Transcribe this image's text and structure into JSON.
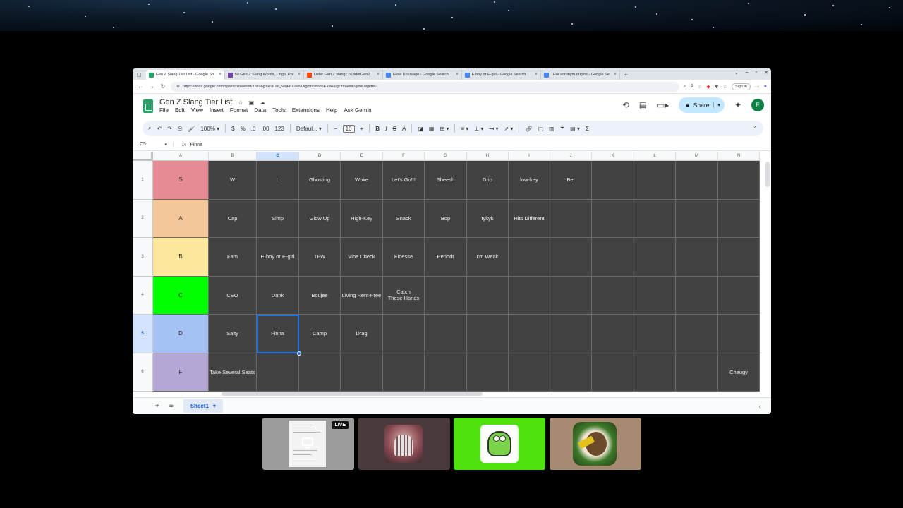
{
  "browser": {
    "tabs": [
      {
        "title": "Gen Z Slang Tier List - Google Sh",
        "fav_color": "#1fa463",
        "active": true
      },
      {
        "title": "50 Gen Z Slang Words, Lingo, Phr",
        "fav_color": "#6e3fa8",
        "active": false
      },
      {
        "title": "Older Gen Z slang : r/OlderGenZ",
        "fav_color": "#ff4500",
        "active": false
      },
      {
        "title": "Glow Up usage - Google Search",
        "fav_color": "#4285f4",
        "active": false
      },
      {
        "title": "E-boy or E-girl - Google Search",
        "fav_color": "#4285f4",
        "active": false
      },
      {
        "title": "TFW acronym origins - Google Se",
        "fav_color": "#4285f4",
        "active": false
      }
    ],
    "url": "https://docs.google.com/spreadsheets/d/18Ju6gYRDOeQViqFhXaw9UIgl5hbXod5EaWuugcItio/edit?gid=0#gid=0",
    "signin_label": "Sign in"
  },
  "sheet": {
    "title": "Gen Z Slang Tier List",
    "menu": [
      "File",
      "Edit",
      "View",
      "Insert",
      "Format",
      "Data",
      "Tools",
      "Extensions",
      "Help",
      "Ask Gemini"
    ],
    "share_label": "Share",
    "avatar_letter": "E",
    "toolbar": {
      "zoom": "100%",
      "font": "Defaul...",
      "font_size": "10",
      "percent": "%",
      "dec_less": ".0",
      "dec_more": ".00",
      "format_123": "123"
    },
    "namebox": "C5",
    "formula": "Finna",
    "columns": [
      "A",
      "B",
      "C",
      "D",
      "E",
      "F",
      "G",
      "H",
      "I",
      "J",
      "K",
      "L",
      "M",
      "N"
    ],
    "selected_column": "C",
    "selected_row": 5,
    "rows": [
      {
        "num": "1",
        "tier": "S",
        "tier_color": "#e68a93",
        "items": [
          "W",
          "L",
          "Ghosting",
          "Woke",
          "Let's Go!!!",
          "Sheesh",
          "Drip",
          "low-key",
          "Bet",
          "",
          "",
          "",
          ""
        ]
      },
      {
        "num": "2",
        "tier": "A",
        "tier_color": "#f4c79a",
        "items": [
          "Cap",
          "Simp",
          "Glow Up",
          "High-Key",
          "Snack",
          "Bop",
          "tykyk",
          "Hits Different",
          "",
          "",
          "",
          "",
          ""
        ]
      },
      {
        "num": "3",
        "tier": "B",
        "tier_color": "#fce79c",
        "items": [
          "Fam",
          "E-boy or E-girl",
          "TFW",
          "Vibe Check",
          "Finesse",
          "Periodt",
          "I'm Weak",
          "",
          "",
          "",
          "",
          "",
          ""
        ]
      },
      {
        "num": "4",
        "tier": "C",
        "tier_color": "#00ff00",
        "items": [
          "CEO",
          "Dank",
          "Boujee",
          "Living Rent-Free",
          "Catch\nThese Hands",
          "",
          "",
          "",
          "",
          "",
          "",
          "",
          ""
        ]
      },
      {
        "num": "5",
        "tier": "D",
        "tier_color": "#a4c2f4",
        "items": [
          "Salty",
          "Finna",
          "Camp",
          "Drag",
          "",
          "",
          "",
          "",
          "",
          "",
          "",
          "",
          ""
        ]
      },
      {
        "num": "6",
        "tier": "F",
        "tier_color": "#b4a7d6",
        "items": [
          "Take Several Seats",
          "",
          "",
          "",
          "",
          "",
          "",
          "",
          "",
          "",
          "",
          "",
          "Cheugy"
        ]
      }
    ],
    "sheet_tab": "Sheet1"
  },
  "meeting": {
    "live_label": "LIVE",
    "accent_green": "#4ee20f"
  }
}
